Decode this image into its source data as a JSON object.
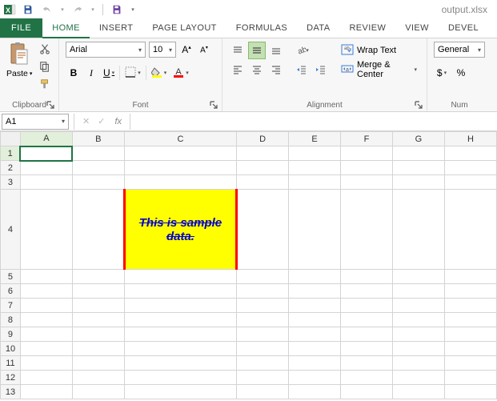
{
  "window": {
    "filename": "output.xlsx"
  },
  "tabs": {
    "file": "FILE",
    "list": [
      "HOME",
      "INSERT",
      "PAGE LAYOUT",
      "FORMULAS",
      "DATA",
      "REVIEW",
      "VIEW",
      "DEVEL"
    ],
    "active": 0
  },
  "ribbon": {
    "clipboard": {
      "paste": "Paste",
      "label": "Clipboard"
    },
    "font": {
      "name": "Arial",
      "size": "10",
      "label": "Font"
    },
    "alignment": {
      "wrap": "Wrap Text",
      "merge": "Merge & Center",
      "label": "Alignment"
    },
    "number": {
      "format": "General",
      "dollar": "$",
      "percent": "%",
      "label": "Num"
    }
  },
  "namebox": "A1",
  "fx": "fx",
  "columns": [
    "A",
    "B",
    "C",
    "D",
    "E",
    "F",
    "G",
    "H"
  ],
  "rows": [
    "1",
    "2",
    "3",
    "4",
    "5",
    "6",
    "7",
    "8",
    "9",
    "10",
    "11",
    "12",
    "13"
  ],
  "cells": {
    "C4": "This is sample data."
  }
}
